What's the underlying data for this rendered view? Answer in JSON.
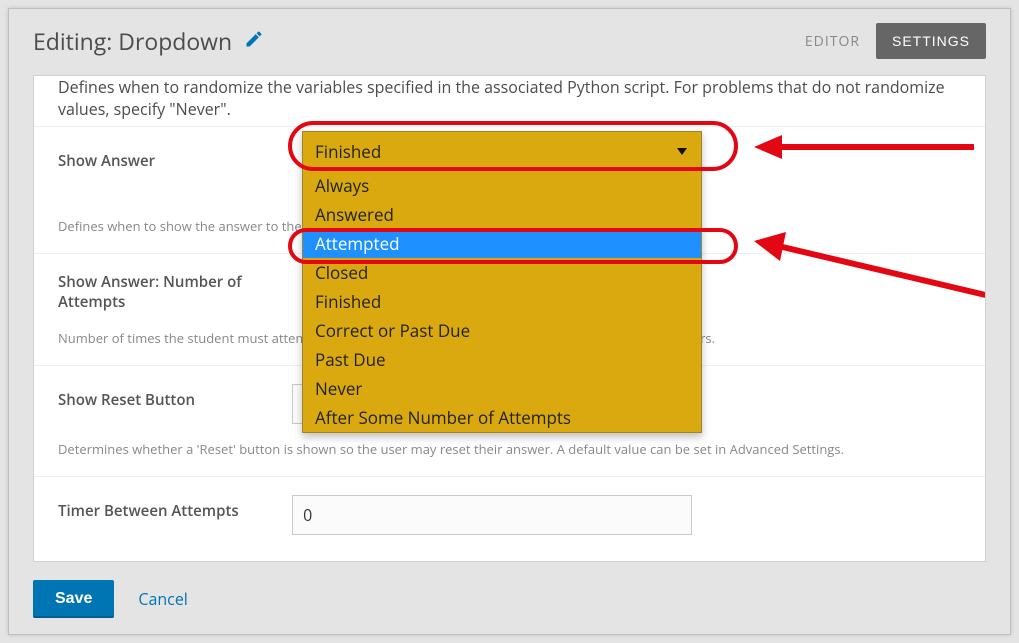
{
  "header": {
    "title": "Editing: Dropdown",
    "tabs": {
      "editor": "EDITOR",
      "settings": "SETTINGS"
    }
  },
  "rows": {
    "randomize_help_trunc": "Defines when to randomize the variables specified in the associated Python script. For problems that do not randomize values, specify \"Never\".",
    "show_answer": {
      "label": "Show Answer",
      "selected": "Finished",
      "highlighted": "Attempted",
      "options": [
        "Always",
        "Answered",
        "Attempted",
        "Closed",
        "Finished",
        "Correct or Past Due",
        "Past Due",
        "Never",
        "After Some Number of Attempts"
      ],
      "help": "Defines when to show the answer to the problem. A default value can be set in Advanced Settings."
    },
    "show_answer_attempts": {
      "label": "Show Answer: Number of Attempts",
      "help": "Number of times the student must attempt to answer the question before the Show Answer button appears."
    },
    "show_reset": {
      "label": "Show Reset Button",
      "value": "False",
      "help": "Determines whether a 'Reset' button is shown so the user may reset their answer. A default value can be set in Advanced Settings."
    },
    "timer": {
      "label": "Timer Between Attempts",
      "value": "0"
    }
  },
  "footer": {
    "save": "Save",
    "cancel": "Cancel"
  },
  "spacer_before": 380,
  "spacer_after": 40
}
